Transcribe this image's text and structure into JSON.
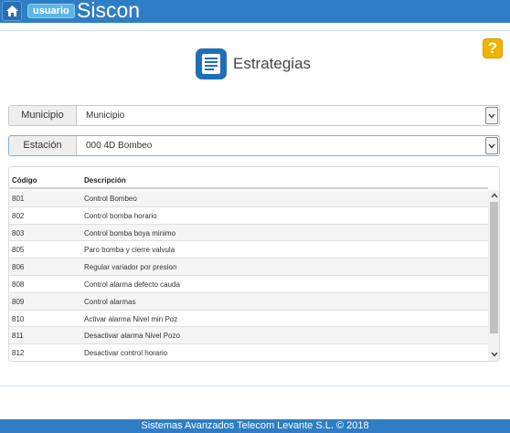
{
  "header": {
    "home_icon": "home-icon",
    "user_label": "usuario",
    "app_title": "Siscon",
    "accent_color": "#2f7dc4"
  },
  "help": {
    "label": "?"
  },
  "page": {
    "icon": "document-icon",
    "title": "Estrategias"
  },
  "filters": {
    "municipio": {
      "label": "Municipio",
      "value": "Municipio"
    },
    "estacion": {
      "label": "Estación",
      "value": "000 4D Bombeo"
    }
  },
  "table": {
    "columns": [
      "Código",
      "Descripción"
    ],
    "rows": [
      [
        "801",
        "Control Bombeo"
      ],
      [
        "802",
        "Control bomba horario"
      ],
      [
        "803",
        "Control bomba boya minimo"
      ],
      [
        "805",
        "Paro bomba y cierre valvula"
      ],
      [
        "806",
        "Regular variador por presion"
      ],
      [
        "808",
        "Control alarma defecto cauda"
      ],
      [
        "809",
        "Control alarmas"
      ],
      [
        "810",
        "Activar alarma Nivel min Poz"
      ],
      [
        "811",
        "Desactivar alarma Nivel Pozo"
      ],
      [
        "812",
        "Desactivar control horario"
      ]
    ]
  },
  "footer": {
    "text": "Sistemas Avanzados Telecom Levante S.L. © 2018"
  }
}
